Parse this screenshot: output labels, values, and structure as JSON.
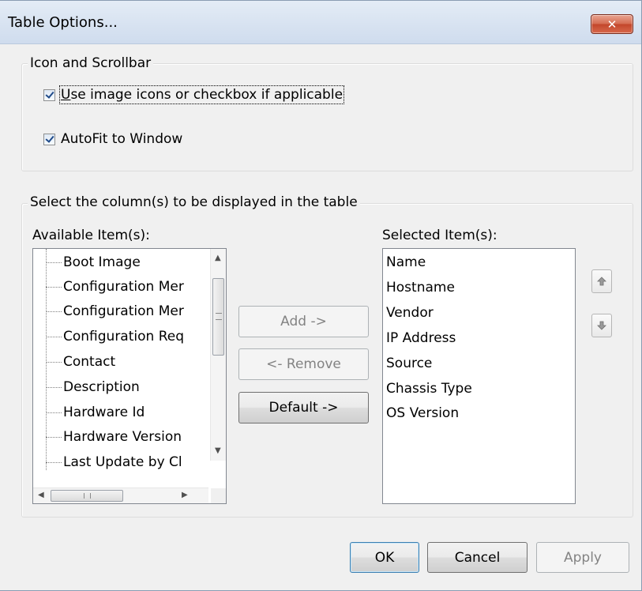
{
  "window": {
    "title": "Table Options...",
    "close_symbol": "✕"
  },
  "icon_group": {
    "title": "Icon and Scrollbar",
    "use_image_icons": {
      "label_first": "U",
      "label_rest": "se image icons or checkbox if applicable",
      "checked": true
    },
    "autofit": {
      "label": "AutoFit to Window",
      "checked": true
    }
  },
  "columns_group": {
    "title": "Select the column(s) to be displayed in the table",
    "available_label": "Available Item(s):",
    "selected_label": "Selected Item(s):",
    "available_items": [
      "Boot Image",
      "Configuration Mer",
      "Configuration Mer",
      "Configuration Req",
      "Contact",
      "Description",
      "Hardware Id",
      "Hardware Version",
      "Last Update by Cl"
    ],
    "selected_items": [
      "Name",
      "Hostname",
      "Vendor",
      "IP Address",
      "Source",
      "Chassis Type",
      "OS Version"
    ],
    "add_label": "Add ->",
    "remove_label": "<- Remove",
    "default_label": "Default ->",
    "move_up_icon": "arrow-up-icon",
    "move_down_icon": "arrow-down-icon"
  },
  "footer": {
    "ok": "OK",
    "cancel": "Cancel",
    "apply": "Apply"
  }
}
